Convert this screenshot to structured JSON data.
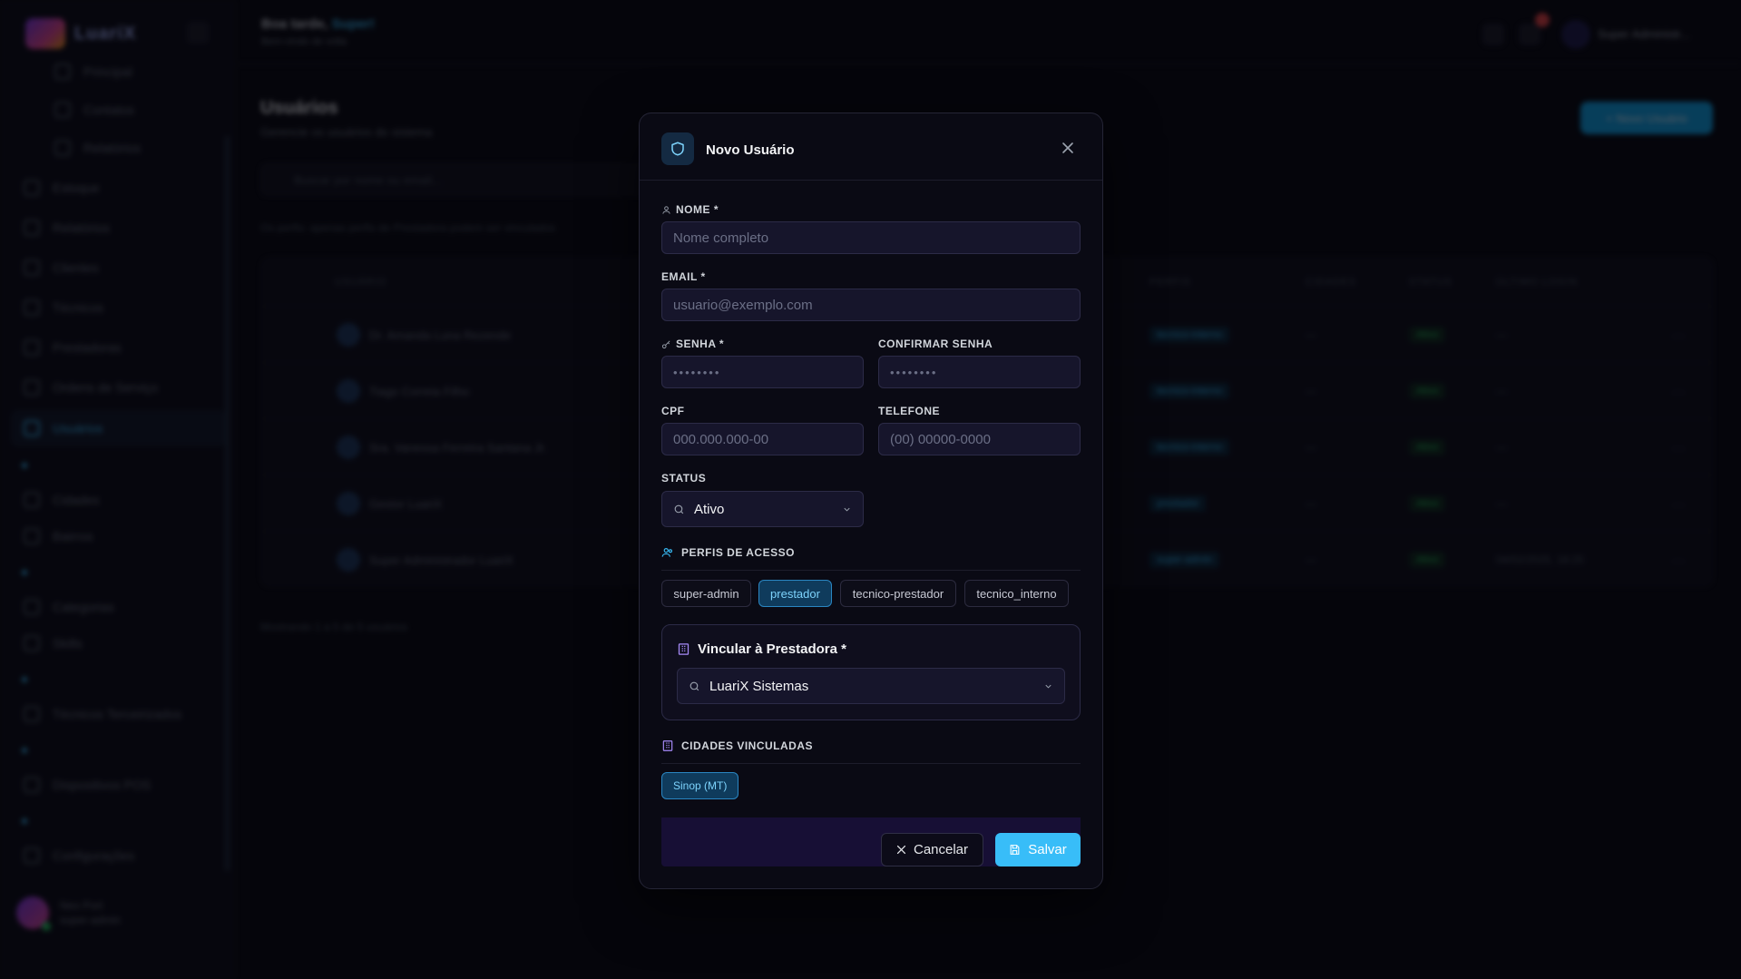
{
  "sidebar": {
    "brand": "LuariX",
    "items": [
      {
        "label": "Principal"
      },
      {
        "label": "Contatos"
      },
      {
        "label": "Relatórios"
      },
      {
        "label": "Estoque"
      },
      {
        "label": "Relatórios"
      },
      {
        "label": "Clientes"
      },
      {
        "label": "Técnicos"
      },
      {
        "label": "Prestadoras"
      },
      {
        "label": "Ordens de Serviço"
      },
      {
        "label": "Usuários"
      },
      {
        "label": "Cidades"
      },
      {
        "label": "Bairros"
      },
      {
        "label": "Categorias"
      },
      {
        "label": "Skills"
      },
      {
        "label": "Técnicos Terceirizados"
      },
      {
        "label": "Dispositivos POS"
      },
      {
        "label": "Configurações"
      }
    ],
    "user": {
      "name": "Neo Port",
      "role": "super-admin"
    }
  },
  "topbar": {
    "greeting": "Boa tarde,",
    "greeting_name": "Super!",
    "subtitle": "Bem-vindo de volta",
    "user": "Super Administr..."
  },
  "page": {
    "title": "Usuários",
    "subtitle": "Gerencie os usuários do sistema",
    "new_button": "+ Novo Usuário",
    "search_placeholder": "Buscar por nome ou email...",
    "hint": "Os perfis: apenas perfis de Prestadora podem ser vinculados",
    "table": {
      "headers": [
        "USUÁRIO",
        "PERFIS",
        "CIDADES",
        "STATUS",
        "ÚLTIMO LOGIN"
      ],
      "rows": [
        {
          "name": "Dr. Amanda Luna Rezende",
          "profile": "tecnico-interno",
          "city": "—",
          "status": "Ativo",
          "last": "—"
        },
        {
          "name": "Tiago Correia Filho",
          "profile": "tecnico-interno",
          "city": "—",
          "status": "Ativo",
          "last": "—"
        },
        {
          "name": "Sra. Vanessa Ferreira Santana Jr.",
          "profile": "tecnico-interno",
          "city": "—",
          "status": "Ativo",
          "last": "—"
        },
        {
          "name": "Gestor LuariX",
          "profile": "prestador",
          "city": "—",
          "status": "Ativo",
          "last": "—"
        },
        {
          "name": "Super Administrador LuariX",
          "profile": "super-admin",
          "city": "—",
          "status": "Ativo",
          "last": "04/02/2025, 18:25"
        }
      ]
    },
    "pager": "Mostrando 1 a 5 de 5 usuários"
  },
  "modal": {
    "title": "Novo Usuário",
    "nome": {
      "label": "NOME *",
      "placeholder": "Nome completo",
      "value": ""
    },
    "email": {
      "label": "EMAIL *",
      "placeholder": "usuario@exemplo.com",
      "value": ""
    },
    "senha": {
      "label": "SENHA *",
      "placeholder": "••••••••"
    },
    "confirmar": {
      "label": "CONFIRMAR SENHA",
      "placeholder": "••••••••"
    },
    "cpf": {
      "label": "CPF",
      "placeholder": "000.000.000-00"
    },
    "telefone": {
      "label": "TELEFONE",
      "placeholder": "(00) 00000-0000"
    },
    "status": {
      "label": "STATUS",
      "value": "Ativo"
    },
    "perfis": {
      "label": "PERFIS DE ACESSO",
      "options": [
        {
          "label": "super-admin",
          "selected": false
        },
        {
          "label": "prestador",
          "selected": true
        },
        {
          "label": "tecnico-prestador",
          "selected": false
        },
        {
          "label": "tecnico_interno",
          "selected": false
        }
      ]
    },
    "vincular": {
      "label": "Vincular à Prestadora *",
      "value": "LuariX Sistemas"
    },
    "cidades": {
      "label": "CIDADES VINCULADAS",
      "items": [
        "Sinop (MT)"
      ]
    },
    "cancel_label": "Cancelar",
    "save_label": "Salvar"
  },
  "colors": {
    "accent": "#38bdf8",
    "modal_bg": "#0a0a14",
    "input_bg": "#16152b",
    "chip_selected_bg": "#0f3b5c",
    "footer_bg": "#170f35"
  }
}
